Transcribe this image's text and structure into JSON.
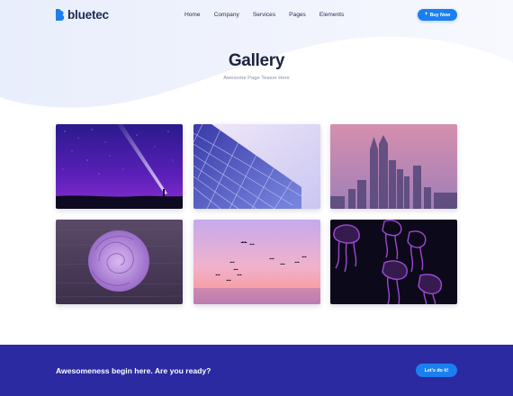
{
  "brand": {
    "name": "bluetec"
  },
  "nav": {
    "links": [
      "Home",
      "Company",
      "Services",
      "Pages",
      "Elements"
    ],
    "cta_label": "Buy Now"
  },
  "hero": {
    "title": "Gallery",
    "subtitle": "Awesome Page Teaser Here"
  },
  "gallery": {
    "images": [
      {
        "subject": "starry night sky with light beam"
      },
      {
        "subject": "geometric building facade"
      },
      {
        "subject": "city skyline in pink haze"
      },
      {
        "subject": "purple rose on wood"
      },
      {
        "subject": "birds over pink sunset sea"
      },
      {
        "subject": "glowing purple jellyfish"
      }
    ]
  },
  "cta": {
    "text": "Awesomeness begin here. Are you ready?",
    "button_label": "Let's do it!"
  },
  "colors": {
    "accent": "#1b7ff0",
    "cta_band": "#2b2aa0",
    "heading": "#1d2340",
    "hero_wave": "#eef2fd"
  }
}
